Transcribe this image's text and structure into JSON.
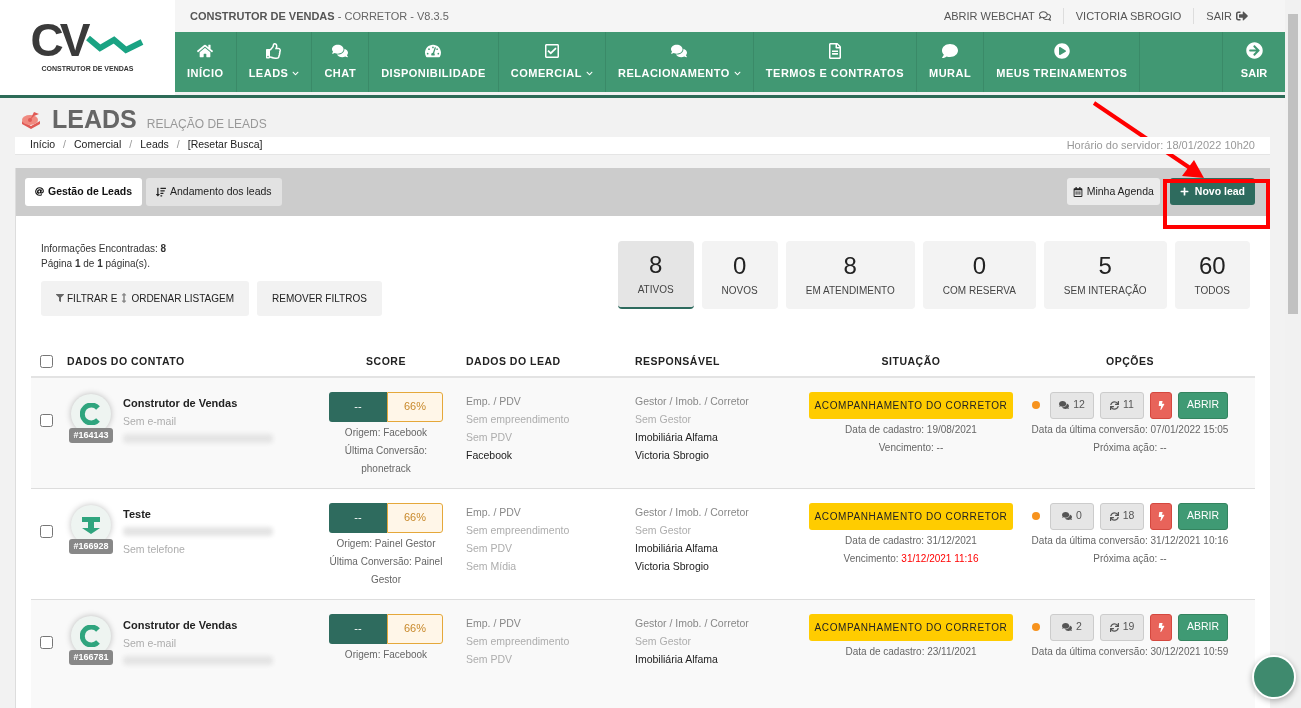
{
  "app": {
    "title": "CONSTRUTOR DE VENDAS",
    "subtitle": "- CORRETOR - V8.3.5"
  },
  "logo": {
    "mark": "CV",
    "caption": "CONSTRUTOR DE VENDAS"
  },
  "top_links": [
    {
      "label": "ABRIR WEBCHAT",
      "kind": "chat"
    },
    {
      "label": "VICTORIA SBROGIO",
      "kind": "user"
    },
    {
      "label": "SAIR",
      "kind": "exit"
    }
  ],
  "nav": [
    {
      "label": "INÍCIO",
      "dropdown": false
    },
    {
      "label": "LEADS",
      "dropdown": true
    },
    {
      "label": "CHAT",
      "dropdown": false
    },
    {
      "label": "DISPONIBILIDADE",
      "dropdown": false
    },
    {
      "label": "COMERCIAL",
      "dropdown": true
    },
    {
      "label": "RELACIONAMENTO",
      "dropdown": true
    },
    {
      "label": "TERMOS E CONTRATOS",
      "dropdown": false
    },
    {
      "label": "MURAL",
      "dropdown": false
    },
    {
      "label": "MEUS TREINAMENTOS",
      "dropdown": false
    }
  ],
  "nav_exit": {
    "label": "SAIR"
  },
  "page": {
    "title": "LEADS",
    "subtitle": "RELAÇÃO DE LEADS"
  },
  "breadcrumb": [
    "Início",
    "Comercial",
    "Leads",
    "[Resetar Busca]"
  ],
  "breadcrumb_separator": "/",
  "server_time": "Horário do servidor: 18/01/2022 10h20",
  "tabs": [
    {
      "label": "Gestão de Leads",
      "selected": true
    },
    {
      "label": "Andamento dos leads",
      "selected": false
    }
  ],
  "actions": [
    {
      "label": "Minha Agenda",
      "kind": "calendar"
    },
    {
      "label": "Novo lead",
      "kind": "primary"
    }
  ],
  "summary": [
    "Informações Encontradas: **8**",
    "Página **1** de **1** página(s)."
  ],
  "filter_buttons": [
    {
      "kind": "filter",
      "label": "FILTRAR E",
      "label_after": "ORDENAR LISTAGEM"
    },
    {
      "kind": "plain",
      "label": "REMOVER FILTROS"
    }
  ],
  "stats": [
    {
      "value": "8",
      "label": "ATIVOS",
      "selected": true
    },
    {
      "value": "0",
      "label": "NOVOS",
      "selected": false
    },
    {
      "value": "8",
      "label": "EM ATENDIMENTO",
      "selected": false
    },
    {
      "value": "0",
      "label": "COM RESERVA",
      "selected": false
    },
    {
      "value": "5",
      "label": "SEM INTERAÇÃO",
      "selected": false
    },
    {
      "value": "60",
      "label": "TODOS",
      "selected": false
    }
  ],
  "table": {
    "select_all": {
      "checked": false
    },
    "columns": [
      "DADOS DO CONTATO",
      "SCORE",
      "DADOS DO LEAD",
      "RESPONSÁVEL",
      "SITUAÇÃO",
      "OPÇÕES"
    ],
    "rows": [
      {
        "checked": false,
        "kind": "c",
        "id": "#164143",
        "name": "Construtor de Vendas",
        "contact": [
          {
            "kind": "empty",
            "text": "Sem e-mail"
          },
          {
            "kind": "blurred"
          }
        ],
        "score": {
          "value": "--",
          "percent": "66%"
        },
        "origin": [
          "Origem: Facebook",
          "Última Conversão: phonetrack"
        ],
        "lead": [
          {
            "kind": "label",
            "text": "Emp. / PDV"
          },
          {
            "kind": "empty",
            "text": "Sem empreendimento"
          },
          {
            "kind": "empty",
            "text": "Sem PDV"
          },
          {
            "kind": "value",
            "text": "Facebook"
          }
        ],
        "responsible": [
          {
            "kind": "label",
            "text": "Gestor / Imob. / Corretor"
          },
          {
            "kind": "empty",
            "text": "Sem Gestor"
          },
          {
            "kind": "value",
            "text": "Imobiliária Alfama"
          },
          {
            "kind": "value",
            "text": "Victoria Sbrogio"
          }
        ],
        "status": "ACOMPANHAMENTO DO CORRETOR",
        "registered": "Data de cadastro: 19/08/2021",
        "due_label": "Vencimento:",
        "due": "--",
        "overdue": false,
        "color": "#f7931e",
        "messages": "12",
        "syncs": "11",
        "open": "ABRIR",
        "last_conversion": "Data da última conversão: 07/01/2022 15:05",
        "next_action": "Próxima ação: --"
      },
      {
        "checked": false,
        "kind": "t",
        "id": "#166928",
        "name": "Teste",
        "contact": [
          {
            "kind": "blurred"
          },
          {
            "kind": "empty",
            "text": "Sem telefone"
          }
        ],
        "score": {
          "value": "--",
          "percent": "66%"
        },
        "origin": [
          "Origem: Painel Gestor",
          "Última Conversão: Painel Gestor"
        ],
        "lead": [
          {
            "kind": "label",
            "text": "Emp. / PDV"
          },
          {
            "kind": "empty",
            "text": "Sem empreendimento"
          },
          {
            "kind": "empty",
            "text": "Sem PDV"
          },
          {
            "kind": "empty",
            "text": "Sem Mídia"
          }
        ],
        "responsible": [
          {
            "kind": "label",
            "text": "Gestor / Imob. / Corretor"
          },
          {
            "kind": "empty",
            "text": "Sem Gestor"
          },
          {
            "kind": "value",
            "text": "Imobiliária Alfama"
          },
          {
            "kind": "value",
            "text": "Victoria Sbrogio"
          }
        ],
        "status": "ACOMPANHAMENTO DO CORRETOR",
        "registered": "Data de cadastro: 31/12/2021",
        "due_label": "Vencimento:",
        "due": "31/12/2021 11:16",
        "overdue": true,
        "color": "#f7931e",
        "messages": "0",
        "syncs": "18",
        "open": "ABRIR",
        "last_conversion": "Data da última conversão: 31/12/2021 10:16",
        "next_action": "Próxima ação: --"
      },
      {
        "checked": false,
        "kind": "c",
        "id": "#166781",
        "name": "Construtor de Vendas",
        "contact": [
          {
            "kind": "empty",
            "text": "Sem e-mail"
          },
          {
            "kind": "blurred"
          }
        ],
        "score": {
          "value": "--",
          "percent": "66%"
        },
        "origin": [
          "Origem: Facebook"
        ],
        "lead": [
          {
            "kind": "label",
            "text": "Emp. / PDV"
          },
          {
            "kind": "empty",
            "text": "Sem empreendimento"
          },
          {
            "kind": "empty",
            "text": "Sem PDV"
          }
        ],
        "responsible": [
          {
            "kind": "label",
            "text": "Gestor / Imob. / Corretor"
          },
          {
            "kind": "empty",
            "text": "Sem Gestor"
          },
          {
            "kind": "value",
            "text": "Imobiliária Alfama"
          }
        ],
        "status": "ACOMPANHAMENTO DO CORRETOR",
        "registered": "Data de cadastro: 23/11/2021",
        "color": "#f7931e",
        "messages": "2",
        "syncs": "19",
        "open": "ABRIR",
        "last_conversion": "Data da última conversão: 30/12/2021 10:59"
      }
    ]
  }
}
